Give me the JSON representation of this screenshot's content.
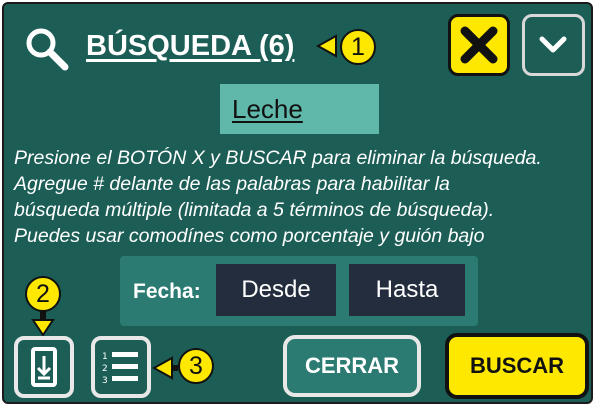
{
  "header": {
    "title": "BÚSQUEDA (6)",
    "search_icon": "search-icon",
    "clear_icon": "close-icon",
    "collapse_icon": "chevron-down-icon"
  },
  "search_term": "Leche",
  "help_lines": [
    "Presione el BOTÓN X y BUSCAR para eliminar la búsqueda.",
    "Agregue # delante de las palabras para habilitar la",
    "búsqueda múltiple (limitada a 5 términos de búsqueda).",
    "Puedes usar comodínes como porcentaje y guión bajo"
  ],
  "date_filter": {
    "label": "Fecha:",
    "from": "Desde",
    "to": "Hasta"
  },
  "footer": {
    "download_icon": "download-device-icon",
    "list_icon": "numbered-list-icon",
    "close_label": "CERRAR",
    "search_label": "BUSCAR"
  },
  "callouts": [
    "1",
    "2",
    "3"
  ],
  "colors": {
    "panel": "#1c5e56",
    "accent_yellow": "#ffe800",
    "term_bg": "#5fb8aa",
    "field_bg": "#232d3d"
  }
}
